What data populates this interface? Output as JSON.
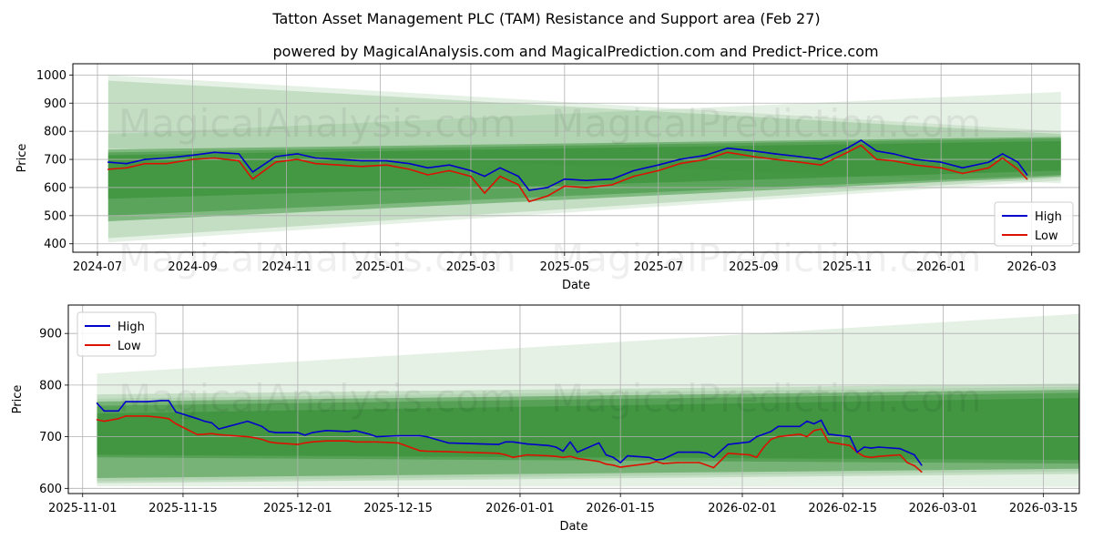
{
  "title": "Tatton Asset Management PLC (TAM) Resistance and Support area (Feb 27)",
  "subtitle": "powered by MagicalAnalysis.com and MagicalPrediction.com and Predict-Price.com",
  "watermarks": [
    "MagicalAnalysis.com",
    "MagicalPrediction.com"
  ],
  "colors": {
    "high": "#0000cc",
    "low": "#dd1100",
    "band": "#2e8b2e",
    "grid": "#b0b0b0"
  },
  "chart_data": [
    {
      "type": "line",
      "xlabel": "Date",
      "ylabel": "Price",
      "xlim": [
        "2024-06-15",
        "2026-04-01"
      ],
      "ylim": [
        370,
        1040
      ],
      "xticks": [
        "2024-07",
        "2024-09",
        "2024-11",
        "2025-01",
        "2025-03",
        "2025-05",
        "2025-07",
        "2025-09",
        "2025-11",
        "2026-01",
        "2026-03"
      ],
      "yticks": [
        400,
        500,
        600,
        700,
        800,
        900,
        1000
      ],
      "grid": true,
      "legend": "bottom-right",
      "x": [
        "2024-07-08",
        "2024-07-20",
        "2024-08-01",
        "2024-08-15",
        "2024-09-01",
        "2024-09-15",
        "2024-10-01",
        "2024-10-10",
        "2024-10-25",
        "2024-11-08",
        "2024-11-20",
        "2024-12-05",
        "2024-12-20",
        "2025-01-05",
        "2025-01-20",
        "2025-02-01",
        "2025-02-15",
        "2025-03-01",
        "2025-03-10",
        "2025-03-20",
        "2025-04-01",
        "2025-04-08",
        "2025-04-20",
        "2025-05-01",
        "2025-05-15",
        "2025-06-01",
        "2025-06-15",
        "2025-07-01",
        "2025-07-15",
        "2025-08-01",
        "2025-08-15",
        "2025-09-01",
        "2025-09-15",
        "2025-10-01",
        "2025-10-15",
        "2025-11-01",
        "2025-11-10",
        "2025-11-20",
        "2025-12-01",
        "2025-12-15",
        "2026-01-01",
        "2026-01-15",
        "2026-02-01",
        "2026-02-10",
        "2026-02-20",
        "2026-02-26"
      ],
      "series": [
        {
          "name": "High",
          "values": [
            690,
            685,
            700,
            705,
            715,
            725,
            720,
            655,
            710,
            720,
            705,
            700,
            695,
            695,
            685,
            670,
            680,
            660,
            640,
            670,
            640,
            590,
            600,
            630,
            625,
            630,
            660,
            680,
            700,
            715,
            740,
            730,
            720,
            710,
            700,
            740,
            768,
            730,
            720,
            700,
            690,
            670,
            690,
            720,
            690,
            645
          ]
        },
        {
          "name": "Low",
          "values": [
            665,
            670,
            685,
            685,
            700,
            705,
            695,
            630,
            690,
            700,
            685,
            680,
            675,
            680,
            665,
            645,
            660,
            640,
            580,
            640,
            610,
            550,
            570,
            605,
            600,
            610,
            640,
            660,
            685,
            700,
            725,
            710,
            700,
            690,
            680,
            725,
            750,
            700,
            695,
            680,
            670,
            650,
            670,
            705,
            665,
            630
          ]
        }
      ],
      "bands": [
        {
          "x": [
            "2024-07-08",
            "2026-03-20"
          ],
          "top": [
            1000,
            800
          ],
          "bottom": [
            405,
            625
          ]
        },
        {
          "x": [
            "2024-07-08",
            "2026-03-20"
          ],
          "top": [
            980,
            790
          ],
          "bottom": [
            420,
            635
          ]
        },
        {
          "x": [
            "2024-07-08",
            "2026-03-20"
          ],
          "top": [
            790,
            940
          ],
          "bottom": [
            740,
            615
          ]
        },
        {
          "x": [
            "2024-07-08",
            "2026-03-20"
          ],
          "top": [
            735,
            780
          ],
          "bottom": [
            480,
            640
          ]
        },
        {
          "x": [
            "2024-07-08",
            "2026-03-20"
          ],
          "top": [
            725,
            775
          ],
          "bottom": [
            500,
            645
          ]
        },
        {
          "x": [
            "2024-07-08",
            "2026-03-20"
          ],
          "top": [
            715,
            765
          ],
          "bottom": [
            560,
            660
          ]
        }
      ]
    },
    {
      "type": "line",
      "xlabel": "Date",
      "ylabel": "Price",
      "xlim": [
        "2025-10-30",
        "2026-03-20"
      ],
      "ylim": [
        590,
        955
      ],
      "xticks": [
        "2025-11-01",
        "2025-11-15",
        "2025-12-01",
        "2025-12-15",
        "2026-01-01",
        "2026-01-15",
        "2026-02-01",
        "2026-02-15",
        "2026-03-01",
        "2026-03-15"
      ],
      "yticks": [
        600,
        700,
        800,
        900
      ],
      "grid": true,
      "legend": "top-left",
      "x": [
        "2025-11-03",
        "2025-11-04",
        "2025-11-06",
        "2025-11-07",
        "2025-11-10",
        "2025-11-12",
        "2025-11-13",
        "2025-11-14",
        "2025-11-17",
        "2025-11-18",
        "2025-11-19",
        "2025-11-20",
        "2025-11-24",
        "2025-11-25",
        "2025-11-26",
        "2025-11-27",
        "2025-11-28",
        "2025-12-01",
        "2025-12-02",
        "2025-12-03",
        "2025-12-05",
        "2025-12-08",
        "2025-12-09",
        "2025-12-11",
        "2025-12-12",
        "2025-12-15",
        "2025-12-18",
        "2025-12-19",
        "2025-12-22",
        "2025-12-29",
        "2025-12-30",
        "2025-12-31",
        "2026-01-02",
        "2026-01-05",
        "2026-01-06",
        "2026-01-07",
        "2026-01-08",
        "2026-01-09",
        "2026-01-12",
        "2026-01-13",
        "2026-01-14",
        "2026-01-15",
        "2026-01-16",
        "2026-01-19",
        "2026-01-20",
        "2026-01-21",
        "2026-01-23",
        "2026-01-26",
        "2026-01-27",
        "2026-01-28",
        "2026-01-30",
        "2026-02-02",
        "2026-02-03",
        "2026-02-04",
        "2026-02-05",
        "2026-02-06",
        "2026-02-09",
        "2026-02-10",
        "2026-02-11",
        "2026-02-12",
        "2026-02-13",
        "2026-02-16",
        "2026-02-17",
        "2026-02-18",
        "2026-02-19",
        "2026-02-20",
        "2026-02-23",
        "2026-02-24",
        "2026-02-25"
      ],
      "series": [
        {
          "name": "High",
          "values": [
            765,
            750,
            750,
            768,
            768,
            770,
            770,
            748,
            735,
            730,
            727,
            715,
            730,
            725,
            720,
            710,
            708,
            708,
            703,
            708,
            712,
            710,
            712,
            705,
            700,
            702,
            702,
            700,
            688,
            685,
            690,
            690,
            686,
            683,
            680,
            672,
            690,
            670,
            688,
            665,
            660,
            650,
            663,
            660,
            655,
            657,
            670,
            670,
            668,
            660,
            685,
            690,
            700,
            705,
            710,
            720,
            720,
            730,
            725,
            732,
            705,
            700,
            670,
            680,
            678,
            680,
            677,
            671,
            665
          ]
        },
        {
          "name": "Low",
          "values": [
            733,
            730,
            735,
            740,
            740,
            737,
            735,
            725,
            704,
            705,
            706,
            704,
            700,
            698,
            695,
            690,
            688,
            685,
            688,
            690,
            692,
            692,
            690,
            690,
            690,
            688,
            673,
            672,
            671,
            668,
            665,
            660,
            665,
            663,
            662,
            660,
            662,
            658,
            652,
            647,
            645,
            641,
            643,
            648,
            652,
            648,
            650,
            650,
            645,
            640,
            668,
            665,
            660,
            680,
            695,
            700,
            705,
            700,
            712,
            715,
            690,
            683,
            670,
            662,
            660,
            662,
            665,
            650,
            644
          ]
        }
      ],
      "series_tail_low": {
        "x": [
          "2026-02-26"
        ],
        "values": [
          632
        ]
      },
      "series_tail_high": {
        "x": [
          "2026-02-26"
        ],
        "values": [
          645
        ]
      },
      "bands": [
        {
          "x": [
            "2025-11-03",
            "2026-03-20"
          ],
          "top": [
            822,
            938
          ],
          "bottom": [
            604,
            603
          ]
        },
        {
          "x": [
            "2025-11-03",
            "2026-03-20"
          ],
          "top": [
            782,
            803
          ],
          "bottom": [
            610,
            628
          ]
        },
        {
          "x": [
            "2025-11-03",
            "2026-03-20"
          ],
          "top": [
            774,
            797
          ],
          "bottom": [
            614,
            633
          ]
        },
        {
          "x": [
            "2025-11-03",
            "2026-03-20"
          ],
          "top": [
            768,
            791
          ],
          "bottom": [
            620,
            638
          ]
        },
        {
          "x": [
            "2025-11-03",
            "2026-03-20"
          ],
          "top": [
            760,
            785
          ],
          "bottom": [
            660,
            648
          ]
        },
        {
          "x": [
            "2025-11-03",
            "2026-03-20"
          ],
          "top": [
            745,
            775
          ],
          "bottom": [
            665,
            655
          ]
        }
      ]
    }
  ]
}
